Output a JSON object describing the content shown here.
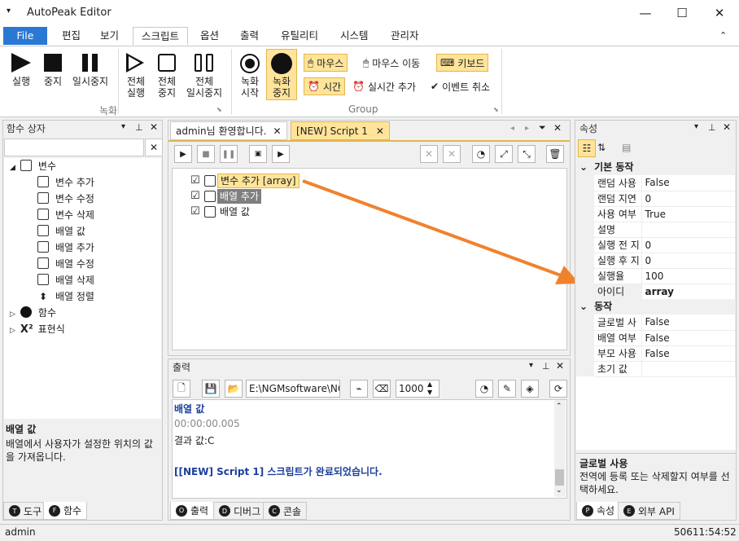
{
  "app": {
    "title": "AutoPeak Editor"
  },
  "window": {
    "minimize": "—",
    "maximize": "☐",
    "close": "✕"
  },
  "menu": {
    "file": "File",
    "items": [
      "편집",
      "보기",
      "스크립트",
      "옵션",
      "출력",
      "유틸리티",
      "시스템",
      "관리자"
    ]
  },
  "ribbon": {
    "run": "실행",
    "stop": "중지",
    "pause": "일시중지",
    "run_all": [
      "전체",
      "실행"
    ],
    "stop_all": [
      "전체",
      "중지"
    ],
    "pause_all": [
      "전체",
      "일시중지"
    ],
    "group1": "녹화",
    "rec_start": [
      "녹화",
      "시작"
    ],
    "rec_stop": [
      "녹화",
      "중지"
    ],
    "mouse": "마우스",
    "mouse_move": "마우스 이동",
    "keyboard": "키보드",
    "time": "시간",
    "realtime_add": "실시간 추가",
    "event_cancel": "이벤트 취소",
    "group2": "Group"
  },
  "left_panel": {
    "title": "함수 상자",
    "tree": {
      "variables": "변수",
      "var_items": [
        "변수 추가",
        "변수 수정",
        "변수 삭제",
        "배열 값",
        "배열 추가",
        "배열 수정",
        "배열 삭제",
        "배열 정렬"
      ],
      "functions": "함수",
      "expressions": "표현식"
    },
    "desc_title": "배열 값",
    "desc": "배열에서 사용자가 설정한 위치의 값을 가져옵니다.",
    "tabs": [
      "도구",
      "함수"
    ]
  },
  "editor": {
    "tabs": [
      "admin님 환영합니다.",
      "[NEW] Script 1"
    ],
    "items": [
      {
        "label": "변수 추가 [array]"
      },
      {
        "label": "배열 추가"
      },
      {
        "label": "배열 값"
      }
    ]
  },
  "output": {
    "title": "출력",
    "path": "E:\\NGMsoftware\\NG",
    "count": "1000",
    "lines": [
      "배열 값",
      "00:00:00.005",
      "결과 값:C",
      "",
      "[[NEW] Script 1] 스크립트가 완료되었습니다."
    ],
    "tabs": [
      "출력",
      "디버그",
      "콘솔"
    ]
  },
  "properties": {
    "title": "속성",
    "cat1": "기본 동작",
    "rows1": [
      [
        "랜덤 사용",
        "False"
      ],
      [
        "랜덤 지연",
        "0"
      ],
      [
        "사용 여부",
        "True"
      ],
      [
        "설명",
        ""
      ],
      [
        "실행 전 지",
        "0"
      ],
      [
        "실행 후 지",
        "0"
      ],
      [
        "실행율",
        "100"
      ],
      [
        "아이디",
        "array"
      ]
    ],
    "cat2": "동작",
    "rows2": [
      [
        "글로벌 사",
        "False"
      ],
      [
        "배열 여부",
        "False"
      ],
      [
        "부모 사용",
        "False"
      ],
      [
        "초기 값",
        ""
      ]
    ],
    "help_title": "글로벌 사용",
    "help": "전역에 등록 또는 삭제할지 여부를 선택하세요.",
    "tabs": [
      "속성",
      "외부 API"
    ]
  },
  "status": {
    "user": "admin",
    "clock": "50611:54:52"
  },
  "colors": {
    "accent": "#2b78d4",
    "highlight": "#ffe49a",
    "arrow": "#f0822e",
    "select": "#7f7f7f"
  }
}
